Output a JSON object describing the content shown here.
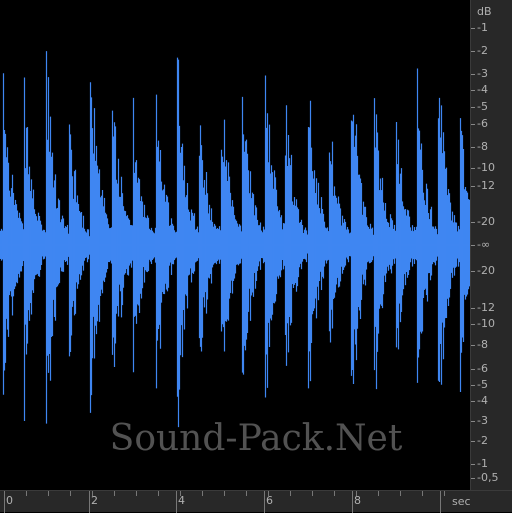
{
  "watermark": "Sound-Pack.Net",
  "colors": {
    "waveform": "#3f86f2",
    "background": "#000000",
    "ruler": "#282828",
    "ruler_text": "#b0b0b0"
  },
  "db_ruler": {
    "unit": "dB",
    "labels_top": [
      "-1",
      "-2",
      "-3",
      "-4",
      "-5",
      "-6",
      "-8",
      "-10",
      "-12",
      "-20"
    ],
    "center": "-∞",
    "labels_bottom": [
      "-20",
      "-12",
      "-10",
      "-8",
      "-6",
      "-5",
      "-4",
      "-3",
      "-2",
      "-1",
      "-0,5"
    ]
  },
  "time_ruler": {
    "unit": "sec",
    "labels": [
      "0",
      "2",
      "4",
      "6",
      "8"
    ]
  }
}
